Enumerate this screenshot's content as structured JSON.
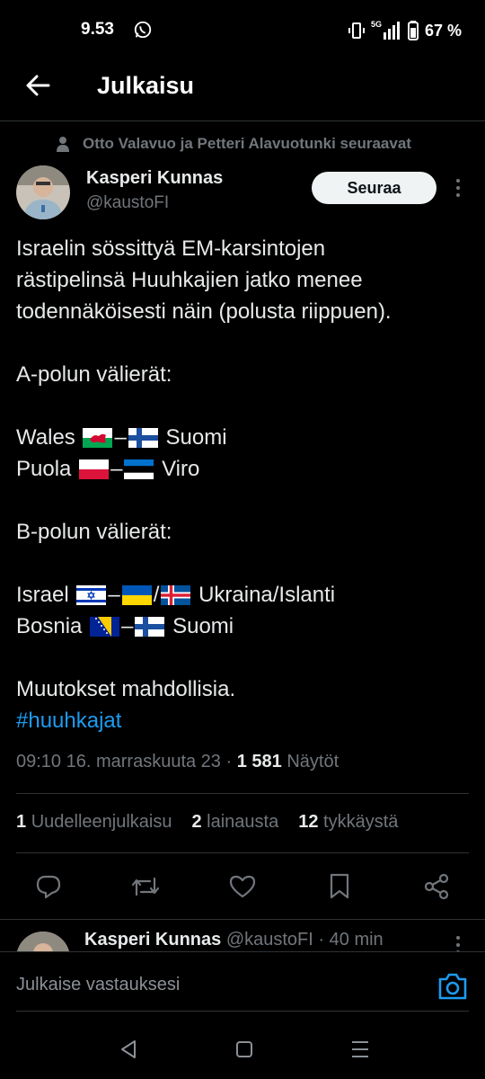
{
  "status_bar": {
    "time": "9.53",
    "network": "5G",
    "battery": "67 %"
  },
  "header": {
    "title": "Julkaisu"
  },
  "social_context": "Otto Valavuo ja Petteri Alavuotunki seuraavat",
  "author": {
    "name": "Kasperi Kunnas",
    "handle": "@kaustoFI",
    "follow_label": "Seuraa"
  },
  "tweet": {
    "text_lines": [
      "Israelin sössittyä EM-karsintojen",
      "rästipelinsä Huuhkajien jatko menee",
      "todennäköisesti näin (polusta riippuen)."
    ],
    "a_heading": "A-polun välierät:",
    "wales_left": "Wales",
    "wales_right": "Suomi",
    "puola_left": "Puola",
    "puola_right": "Viro",
    "b_heading": "B-polun välierät:",
    "israel_left": "Israel",
    "israel_right": "Ukraina/Islanti",
    "bosnia_left": "Bosnia",
    "bosnia_right": "Suomi",
    "outro": "Muutokset mahdollisia.",
    "hashtag": "#huuhkajat",
    "dash": "–",
    "slash": "/"
  },
  "meta": {
    "timestamp": "09:10 16. marraskuuta 23",
    "separator": "·",
    "views_count": "1 581",
    "views_label": "Näytöt"
  },
  "stats": {
    "reposts_count": "1",
    "reposts_label": "Uudelleenjulkaisu",
    "quotes_count": "2",
    "quotes_label": "lainausta",
    "likes_count": "12",
    "likes_label": "tykkäystä"
  },
  "actions": [
    "reply-icon",
    "repost-icon",
    "like-icon",
    "bookmark-icon",
    "share-icon"
  ],
  "reply_preview": {
    "name": "Kasperi Kunnas",
    "handle": "@kaustoFI",
    "separator": "·",
    "time": "40 min"
  },
  "compose": {
    "placeholder": "Julkaise vastauksesi"
  },
  "colors": {
    "background": "#000000",
    "accent": "#1d9bf0",
    "muted": "#71767b",
    "text": "#e7e9ea"
  }
}
